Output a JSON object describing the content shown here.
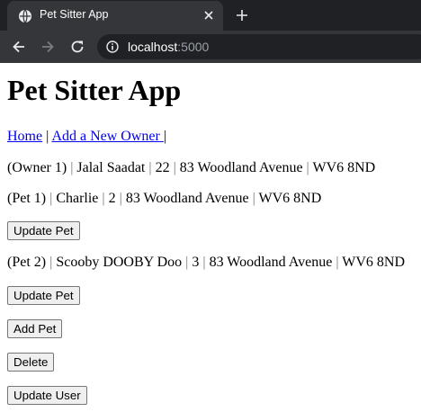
{
  "browser": {
    "tab_title": "Pet Sitter App",
    "url_host": "localhost",
    "url_port": ":5000"
  },
  "page": {
    "title": "Pet Sitter App",
    "nav": {
      "home": "Home",
      "add_owner": "Add a New Owner"
    },
    "owner": {
      "label": "(Owner 1)",
      "name": "Jalal Saadat",
      "age": "22",
      "address": "83 Woodland Avenue",
      "postcode": "WV6 8ND"
    },
    "pets": [
      {
        "label": "(Pet 1)",
        "name": "Charlie",
        "age": "2",
        "address": "83 Woodland Avenue",
        "postcode": "WV6 8ND",
        "button": "Update Pet"
      },
      {
        "label": "(Pet 2)",
        "name": "Scooby DOOBY Doo",
        "age": "3",
        "address": "83 Woodland Avenue",
        "postcode": "WV6 8ND",
        "button": "Update Pet"
      }
    ],
    "buttons": {
      "add_pet": "Add Pet",
      "delete": "Delete",
      "update_user": "Update User"
    }
  }
}
